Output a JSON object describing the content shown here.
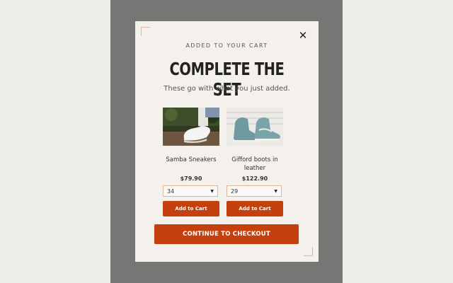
{
  "modal": {
    "eyebrow": "ADDED TO YOUR CART",
    "title": "COMPLETE THE SET",
    "subtitle": "These go with what you just added.",
    "close_icon": "close-icon",
    "checkout_label": "CONTINUE TO CHECKOUT"
  },
  "products": [
    {
      "name": "Samba Sneakers",
      "price": "$79.90",
      "size": "34",
      "button": "Add to Cart",
      "image": "white-sneaker-photo"
    },
    {
      "name": "Gifford boots in leather",
      "price": "$122.90",
      "size": "29",
      "button": "Add to Cart",
      "image": "blue-suede-boot-photo"
    }
  ],
  "colors": {
    "accent": "#c4400f",
    "overlay": "#767774",
    "modal_bg": "#f4f1ec",
    "border": "#e3b39a"
  }
}
